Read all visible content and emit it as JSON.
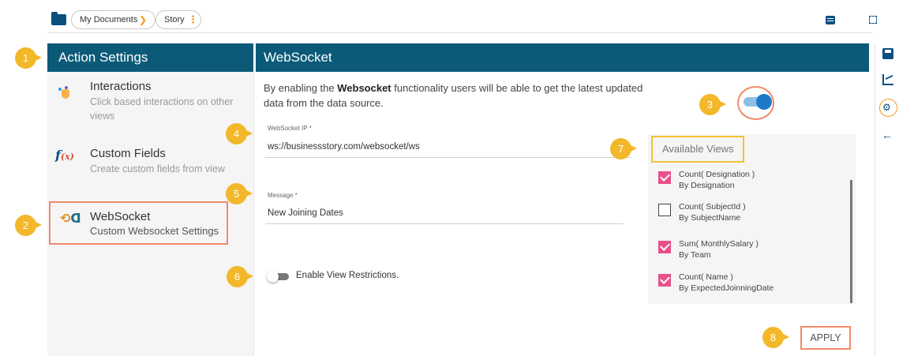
{
  "breadcrumb": {
    "items": [
      "My Documents",
      "Story"
    ]
  },
  "action_settings": {
    "title": "Action Settings",
    "items": [
      {
        "title": "Interactions",
        "desc": "Click based interactions on other views",
        "icon": "interaction-hand-icon"
      },
      {
        "title": "Custom Fields",
        "desc": "Create custom fields from view",
        "icon": "function-fx-icon"
      },
      {
        "title": "WebSocket",
        "desc": "Custom Websocket Settings",
        "icon": "websocket-icon"
      }
    ]
  },
  "websocket": {
    "title": "WebSocket",
    "desc_pre": "By enabling the ",
    "desc_bold": "Websocket",
    "desc_post": " functionality users will be able to get the latest updated data from the data source.",
    "enabled": true,
    "ip_label": "WebSocket IP *",
    "ip_value": "ws://businessstory.com/websocket/ws",
    "message_label": "Message *",
    "message_value": "New Joining Dates",
    "restrictions_label": "Enable View Restrictions.",
    "restrictions_enabled": false
  },
  "available_views": {
    "title": "Available Views",
    "items": [
      {
        "name": "Count( Designation )",
        "by": "By Designation",
        "checked": true
      },
      {
        "name": "Count( SubjectId )",
        "by": "By SubjectName",
        "checked": false
      },
      {
        "name": "Sum( MonthlySalary )",
        "by": "By Team",
        "checked": true
      },
      {
        "name": "Count( Name )",
        "by": "By ExpectedJoinningDate",
        "checked": true
      }
    ]
  },
  "apply_label": "APPLY",
  "callouts": [
    "1",
    "2",
    "3",
    "4",
    "5",
    "6",
    "7",
    "8"
  ],
  "colors": {
    "header": "#0b5a78",
    "accent": "#f29a1e",
    "callout": "#f3b72a",
    "highlight_border": "#f08b6a",
    "checkbox": "#e8508b",
    "toggle_on": "#1d7ac9"
  }
}
